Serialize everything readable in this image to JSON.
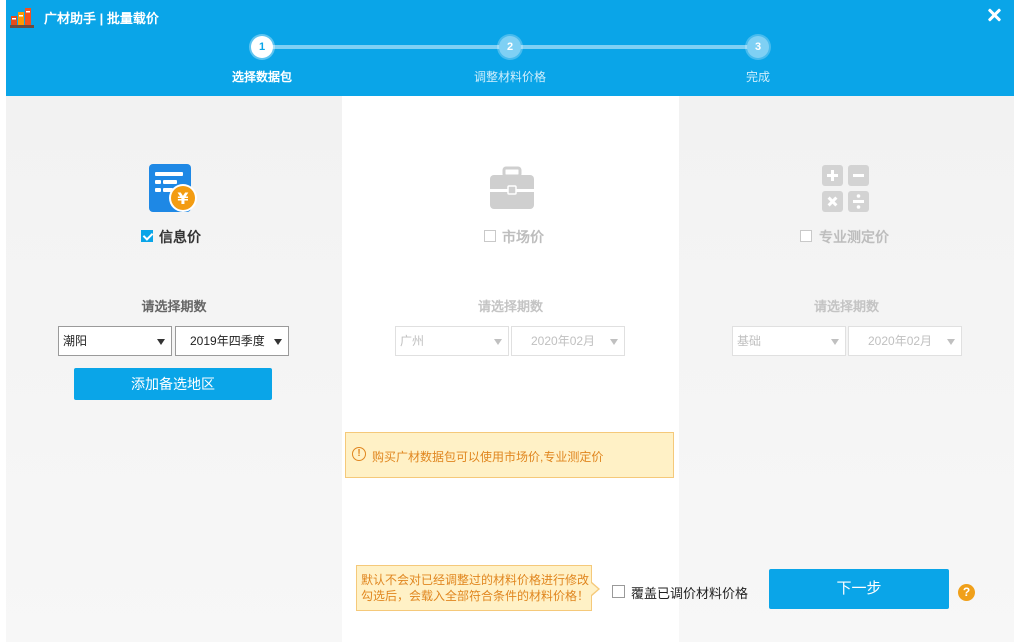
{
  "window": {
    "title": "广材助手 | 批量载价",
    "close_icon": "close-icon"
  },
  "steps": [
    {
      "number": "1",
      "label": "选择数据包",
      "state": "active"
    },
    {
      "number": "2",
      "label": "调整材料价格",
      "state": "inactive"
    },
    {
      "number": "3",
      "label": "完成",
      "state": "inactive"
    }
  ],
  "packages": [
    {
      "label": "信息价",
      "checked": true,
      "enabled": true,
      "icon": "info-price-icon",
      "period_label": "请选择期数",
      "region_select": "潮阳",
      "period_select": "2019年四季度",
      "add_region_button": "添加备选地区"
    },
    {
      "label": "市场价",
      "checked": false,
      "enabled": false,
      "icon": "briefcase-icon",
      "period_label": "请选择期数",
      "region_select": "广州",
      "period_select": "2020年02月"
    },
    {
      "label": "专业测定价",
      "checked": false,
      "enabled": false,
      "icon": "calculator-icon",
      "period_label": "请选择期数",
      "region_select": "基础",
      "period_select": "2020年02月"
    }
  ],
  "notice": {
    "icon": "warning-circle-icon",
    "text": "购买广材数据包可以使用市场价,专业测定价"
  },
  "tip": {
    "line1": "默认不会对已经调整过的材料价格进行修改",
    "line2": "勾选后，会载入全部符合条件的材料价格！"
  },
  "footer": {
    "overwrite_label": "覆盖已调价材料价格",
    "overwrite_checked": false,
    "next_button": "下一步",
    "help_icon": "?"
  },
  "colors": {
    "header_blue": "#0aa5e8",
    "step_inactive": "#7fd0f4",
    "warning_bg": "#fff1c6",
    "warning_text": "#e0861f",
    "help_orange": "#f0a01a"
  }
}
